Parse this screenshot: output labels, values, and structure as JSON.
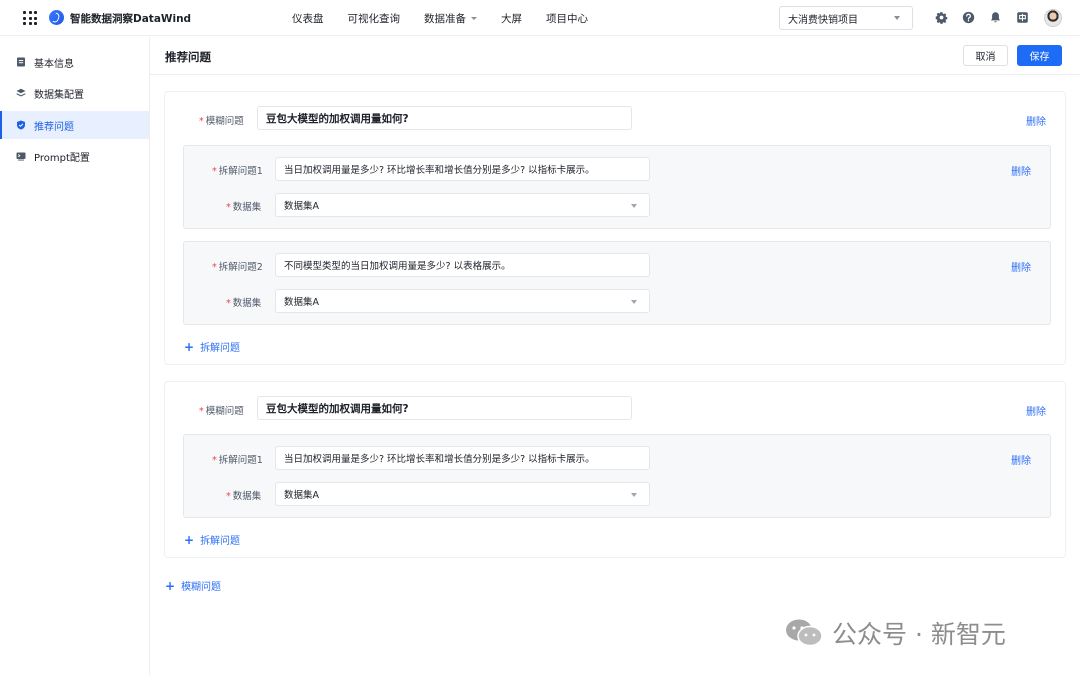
{
  "app": {
    "title": "智能数据洞察DataWind"
  },
  "nav": [
    "仪表盘",
    "可视化查询",
    "数据准备",
    "大屏",
    "项目中心"
  ],
  "project": {
    "selected": "大消费快销项目"
  },
  "sidebar": {
    "items": [
      {
        "label": "基本信息",
        "icon": "document-icon"
      },
      {
        "label": "数据集配置",
        "icon": "layers-icon"
      },
      {
        "label": "推荐问题",
        "icon": "shield-icon",
        "active": true
      },
      {
        "label": "Prompt配置",
        "icon": "prompt-icon"
      }
    ]
  },
  "page": {
    "title": "推荐问题",
    "cancel": "取消",
    "save": "保存"
  },
  "labels": {
    "fuzzy": "模糊问题",
    "sub1": "拆解问题1",
    "sub2": "拆解问题2",
    "dataset": "数据集",
    "delete": "删除",
    "add_sub": "拆解问题",
    "add_fuzzy": "模糊问题"
  },
  "cards": [
    {
      "fuzzy_question": "豆包大模型的加权调用量如何?",
      "sub_questions": [
        {
          "question": "当日加权调用量是多少? 环比增长率和增长值分别是多少? 以指标卡展示。",
          "dataset": "数据集A"
        },
        {
          "question": "不同模型类型的当日加权调用量是多少? 以表格展示。",
          "dataset": "数据集A"
        }
      ]
    },
    {
      "fuzzy_question": "豆包大模型的加权调用量如何?",
      "sub_questions": [
        {
          "question": "当日加权调用量是多少? 环比增长率和增长值分别是多少? 以指标卡展示。",
          "dataset": "数据集A"
        }
      ]
    }
  ],
  "watermark": {
    "text": "公众号 · 新智元"
  }
}
